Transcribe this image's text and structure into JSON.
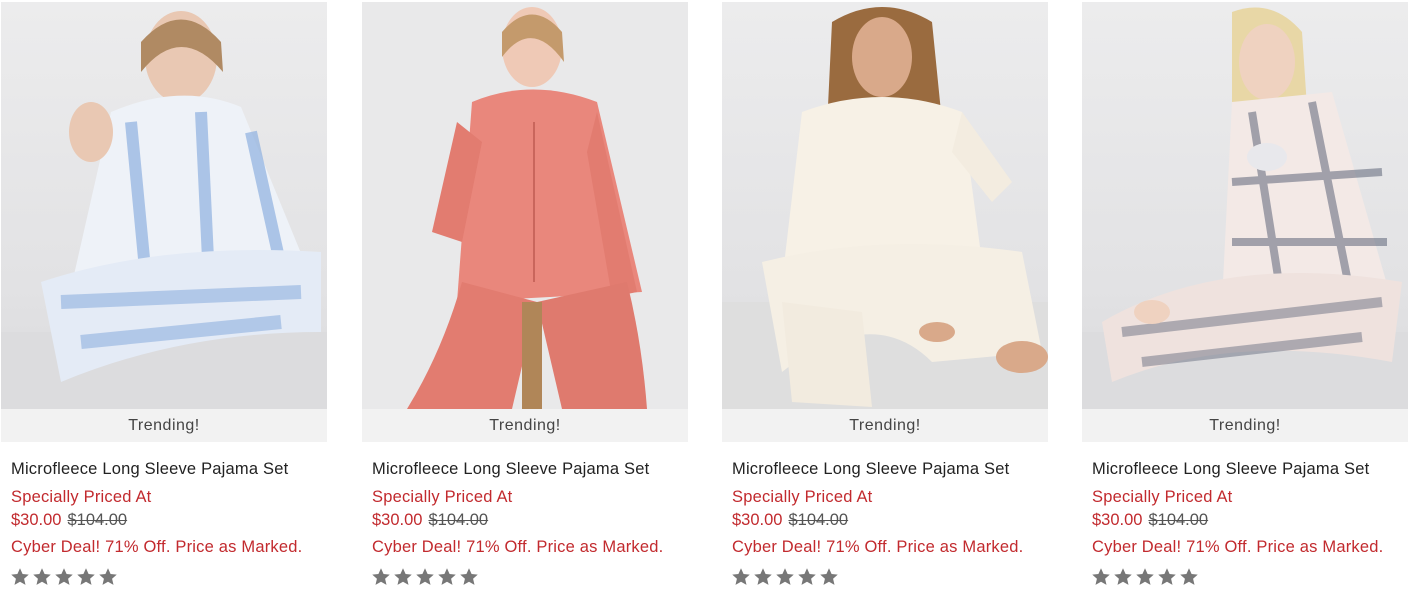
{
  "products": [
    {
      "badge": "Trending!",
      "name": "Microfleece Long Sleeve Pajama Set",
      "promo_label": "Specially Priced At",
      "sale_price": "$30.00",
      "original_price": "$104.00",
      "deal_text": "Cyber Deal! 71% Off. Price as Marked.",
      "rating_stars_filled": 0,
      "rating_stars_total": 5,
      "image_colors": {
        "top": "#eef2f8",
        "bottom": "#dbe5f2",
        "accent": "#8fb0e0"
      }
    },
    {
      "badge": "Trending!",
      "name": "Microfleece Long Sleeve Pajama Set",
      "promo_label": "Specially Priced At",
      "sale_price": "$30.00",
      "original_price": "$104.00",
      "deal_text": "Cyber Deal! 71% Off. Price as Marked.",
      "rating_stars_filled": 0,
      "rating_stars_total": 5,
      "image_colors": {
        "top": "#e9877c",
        "bottom": "#e27c70",
        "accent": "#c9665c"
      }
    },
    {
      "badge": "Trending!",
      "name": "Microfleece Long Sleeve Pajama Set",
      "promo_label": "Specially Priced At",
      "sale_price": "$30.00",
      "original_price": "$104.00",
      "deal_text": "Cyber Deal! 71% Off. Price as Marked.",
      "rating_stars_filled": 0,
      "rating_stars_total": 5,
      "image_colors": {
        "top": "#f7f1e6",
        "bottom": "#f3ece0",
        "accent": "#e6dccb"
      }
    },
    {
      "badge": "Trending!",
      "name": "Microfleece Long Sleeve Pajama Set",
      "promo_label": "Specially Priced At",
      "sale_price": "$30.00",
      "original_price": "$104.00",
      "deal_text": "Cyber Deal! 71% Off. Price as Marked.",
      "rating_stars_filled": 0,
      "rating_stars_total": 5,
      "image_colors": {
        "top": "#f3e9e6",
        "bottom": "#efe2de",
        "accent": "#5d6478"
      }
    }
  ],
  "colors": {
    "price_red": "#c22a2e",
    "badge_bg": "#f2f2f2",
    "star_empty": "#777777"
  }
}
